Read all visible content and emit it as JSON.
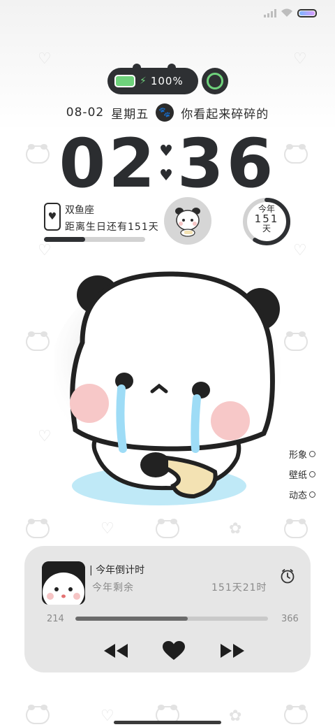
{
  "status": {
    "icons": [
      "signal-icon",
      "wifi-icon",
      "battery-icon"
    ]
  },
  "widget": {
    "battery_pct": "100%",
    "date": "08-02",
    "weekday": "星期五",
    "mood": "你看起来碎碎的",
    "time_h": "02",
    "time_m": "36",
    "zodiac": "双鱼座",
    "birthday_text": "距离生日还有151天",
    "birthday_progress": 0.41,
    "year_label": "今年",
    "year_days": "151",
    "year_unit": "天",
    "year_progress": 0.59
  },
  "side_options": [
    "形象",
    "壁纸",
    "动态"
  ],
  "music": {
    "title": "今年倒计时",
    "subtitle": "今年剩余",
    "remaining": "151天21时",
    "elapsed": "214",
    "total": "366",
    "progress": 0.585
  },
  "colors": {
    "accent": "#6fd27c",
    "dark": "#2e3033",
    "card": "#e6e6e6"
  }
}
